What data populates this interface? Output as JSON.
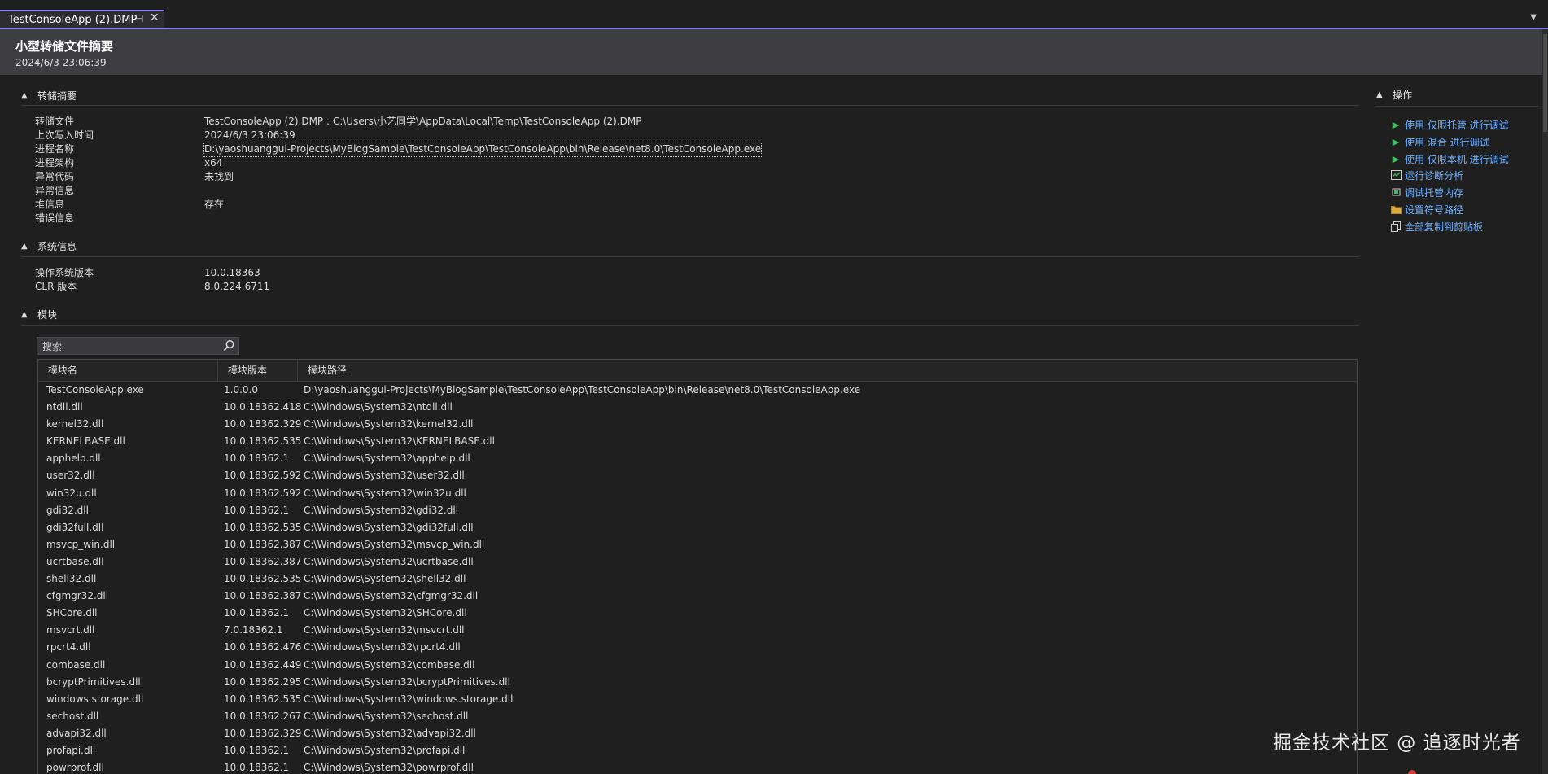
{
  "tab": {
    "title": "TestConsoleApp (2).DMP",
    "pin_glyph": "⊣",
    "close_glyph": "✕"
  },
  "header": {
    "title": "小型转储文件摘要",
    "date": "2024/6/3 23:06:39"
  },
  "sections": {
    "dump_summary": {
      "label": "转储摘要",
      "rows": [
        {
          "key": "转储文件",
          "value": "TestConsoleApp (2).DMP : C:\\Users\\小艺同学\\AppData\\Local\\Temp\\TestConsoleApp (2).DMP"
        },
        {
          "key": "上次写入时间",
          "value": "2024/6/3 23:06:39"
        },
        {
          "key": "进程名称",
          "value": "D:\\yaoshuanggui-Projects\\MyBlogSample\\TestConsoleApp\\TestConsoleApp\\bin\\Release\\net8.0\\TestConsoleApp.exe"
        },
        {
          "key": "进程架构",
          "value": "x64"
        },
        {
          "key": "异常代码",
          "value": "未找到"
        },
        {
          "key": "异常信息",
          "value": ""
        },
        {
          "key": "堆信息",
          "value": "存在"
        },
        {
          "key": "错误信息",
          "value": ""
        }
      ]
    },
    "system_info": {
      "label": "系统信息",
      "rows": [
        {
          "key": "操作系统版本",
          "value": "10.0.18363"
        },
        {
          "key": "CLR 版本",
          "value": "8.0.224.6711"
        }
      ]
    },
    "modules": {
      "label": "模块",
      "search_placeholder": "搜索",
      "columns": [
        "模块名",
        "模块版本",
        "模块路径"
      ],
      "rows": [
        [
          "TestConsoleApp.exe",
          "1.0.0.0",
          "D:\\yaoshuanggui-Projects\\MyBlogSample\\TestConsoleApp\\TestConsoleApp\\bin\\Release\\net8.0\\TestConsoleApp.exe"
        ],
        [
          "ntdll.dll",
          "10.0.18362.418",
          "C:\\Windows\\System32\\ntdll.dll"
        ],
        [
          "kernel32.dll",
          "10.0.18362.329",
          "C:\\Windows\\System32\\kernel32.dll"
        ],
        [
          "KERNELBASE.dll",
          "10.0.18362.535",
          "C:\\Windows\\System32\\KERNELBASE.dll"
        ],
        [
          "apphelp.dll",
          "10.0.18362.1",
          "C:\\Windows\\System32\\apphelp.dll"
        ],
        [
          "user32.dll",
          "10.0.18362.592",
          "C:\\Windows\\System32\\user32.dll"
        ],
        [
          "win32u.dll",
          "10.0.18362.592",
          "C:\\Windows\\System32\\win32u.dll"
        ],
        [
          "gdi32.dll",
          "10.0.18362.1",
          "C:\\Windows\\System32\\gdi32.dll"
        ],
        [
          "gdi32full.dll",
          "10.0.18362.535",
          "C:\\Windows\\System32\\gdi32full.dll"
        ],
        [
          "msvcp_win.dll",
          "10.0.18362.387",
          "C:\\Windows\\System32\\msvcp_win.dll"
        ],
        [
          "ucrtbase.dll",
          "10.0.18362.387",
          "C:\\Windows\\System32\\ucrtbase.dll"
        ],
        [
          "shell32.dll",
          "10.0.18362.535",
          "C:\\Windows\\System32\\shell32.dll"
        ],
        [
          "cfgmgr32.dll",
          "10.0.18362.387",
          "C:\\Windows\\System32\\cfgmgr32.dll"
        ],
        [
          "SHCore.dll",
          "10.0.18362.1",
          "C:\\Windows\\System32\\SHCore.dll"
        ],
        [
          "msvcrt.dll",
          "7.0.18362.1",
          "C:\\Windows\\System32\\msvcrt.dll"
        ],
        [
          "rpcrt4.dll",
          "10.0.18362.476",
          "C:\\Windows\\System32\\rpcrt4.dll"
        ],
        [
          "combase.dll",
          "10.0.18362.449",
          "C:\\Windows\\System32\\combase.dll"
        ],
        [
          "bcryptPrimitives.dll",
          "10.0.18362.295",
          "C:\\Windows\\System32\\bcryptPrimitives.dll"
        ],
        [
          "windows.storage.dll",
          "10.0.18362.535",
          "C:\\Windows\\System32\\windows.storage.dll"
        ],
        [
          "sechost.dll",
          "10.0.18362.267",
          "C:\\Windows\\System32\\sechost.dll"
        ],
        [
          "advapi32.dll",
          "10.0.18362.329",
          "C:\\Windows\\System32\\advapi32.dll"
        ],
        [
          "profapi.dll",
          "10.0.18362.1",
          "C:\\Windows\\System32\\profapi.dll"
        ],
        [
          "powrprof.dll",
          "10.0.18362.1",
          "C:\\Windows\\System32\\powrprof.dll"
        ]
      ]
    }
  },
  "actions": {
    "label": "操作",
    "items": [
      {
        "label": "使用 仅限托管 进行调试",
        "icon": "play-icon"
      },
      {
        "label": "使用 混合 进行调试",
        "icon": "play-icon"
      },
      {
        "label": "使用 仅限本机 进行调试",
        "icon": "play-icon"
      },
      {
        "label": "运行诊断分析",
        "icon": "diagnostics-icon"
      },
      {
        "label": "调试托管内存",
        "icon": "memory-icon"
      },
      {
        "label": "设置符号路径",
        "icon": "folder-icon"
      },
      {
        "label": "全部复制到剪贴板",
        "icon": "copy-icon"
      }
    ]
  },
  "watermark": "掘金技术社区 @ 追逐时光者",
  "colors": {
    "accent": "#8b7cf6",
    "link": "#6fb0ff",
    "play": "#3fbf5f",
    "background": "#1f1f1f",
    "header": "#3e3e42"
  }
}
